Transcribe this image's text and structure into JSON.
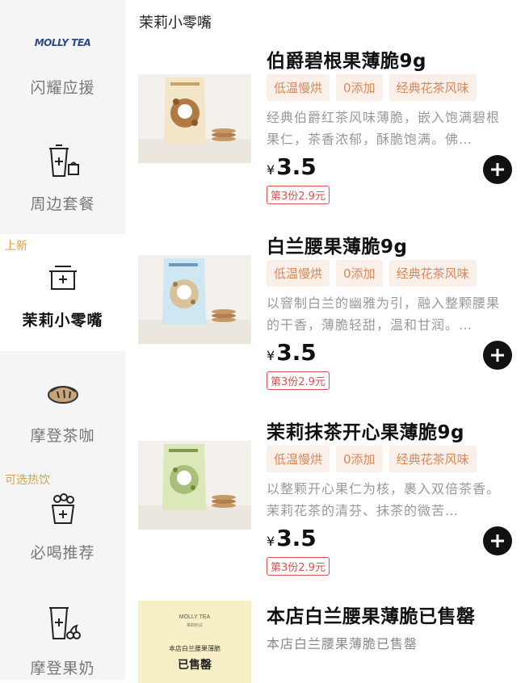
{
  "sidebar": {
    "brand_logo_text": "MOLLY TEA",
    "items": [
      {
        "label": "闪耀应援",
        "icon": "brand-logo",
        "tag": ""
      },
      {
        "label": "周边套餐",
        "icon": "cup-with-bag-icon",
        "tag": ""
      },
      {
        "label": "茉莉小零嘴",
        "icon": "snack-box-icon",
        "tag": "上新",
        "active": true
      },
      {
        "label": "摩登茶咖",
        "icon": "coffee-cookie-icon",
        "tag": ""
      },
      {
        "label": "必喝推荐",
        "icon": "flower-cup-icon",
        "tag": "可选热饮"
      },
      {
        "label": "摩登果奶",
        "icon": "cup-with-cherry-icon",
        "tag": ""
      }
    ]
  },
  "section_title": "茉莉小零嘴",
  "products": [
    {
      "name": "伯爵碧根果薄脆9g",
      "tags": [
        "低温慢烘",
        "0添加",
        "经典花茶风味"
      ],
      "desc": "经典伯爵红茶风味薄脆，嵌入饱满碧根果仁，茶香浓郁，酥脆饱满。佛…",
      "currency": "¥",
      "price": "3.5",
      "promo": "第3份2.9元",
      "bag_color": "#f3e6c8",
      "bag_label": "伯爵碧根果薄脆"
    },
    {
      "name": "白兰腰果薄脆9g",
      "tags": [
        "低温慢烘",
        "0添加",
        "经典花茶风味"
      ],
      "desc": "以窨制白兰的幽雅为引，融入整颗腰果的干香，薄脆轻甜，温和甘润。…",
      "currency": "¥",
      "price": "3.5",
      "promo": "第3份2.9元",
      "bag_color": "#cfe6f3",
      "bag_label": "白兰腰果薄脆"
    },
    {
      "name": "茉莉抹茶开心果薄脆9g",
      "tags": [
        "低温慢烘",
        "0添加",
        "经典花茶风味"
      ],
      "desc": "以整颗开心果仁为核，裹入双倍茶香。茉莉花茶的清芬、抹茶的微苦…",
      "currency": "¥",
      "price": "3.5",
      "promo": "第3份2.9元",
      "bag_color": "#dbe8b8",
      "bag_label": "茉莉抹茶开心果薄脆"
    }
  ],
  "sold_out": {
    "name": "本店白兰腰果薄脆已售罄",
    "desc": "本店白兰腰果薄脆已售罄",
    "image_brand": "MOLLY TEA",
    "image_brand_sub": "茉莉奶白",
    "image_line1": "本店白兰腰果薄脆",
    "image_line2": "已售罄"
  }
}
